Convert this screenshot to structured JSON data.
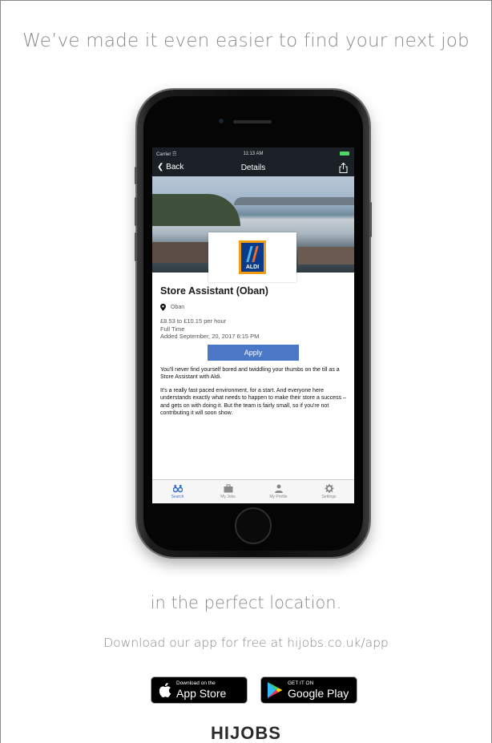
{
  "headline": "We’ve made it even easier to find your next job",
  "phone": {
    "status": {
      "carrier": "Carrier ☶",
      "time": "11:13 AM"
    },
    "nav": {
      "back": "❮ Back",
      "title": "Details"
    },
    "logo_text": "ALDI",
    "job": {
      "title": "Store Assistant (Oban)",
      "location": "Oban",
      "salary": "£8.53 to £10.15 per hour",
      "type": "Full Time",
      "added": "Added September, 20, 2017 6:15 PM",
      "apply_label": "Apply",
      "para1": "You'll never find yourself bored and twiddling your thumbs on the till as a Store Assistant with Aldi.",
      "para2": "It's a really fast paced environment, for a start. And everyone here understands exactly what needs to happen to make their store a success – and gets on with doing it. But the team is fairly small, so if you're not contributing it will soon show."
    },
    "tabs": [
      {
        "label": "Search",
        "icon": "binoculars-icon"
      },
      {
        "label": "My Jobs",
        "icon": "briefcase-icon"
      },
      {
        "label": "My Profile",
        "icon": "person-icon"
      },
      {
        "label": "Settings",
        "icon": "gear-icon"
      }
    ]
  },
  "subheading": "in the perfect location.",
  "download_text": "Download our app for free at hijobs.co.uk/app",
  "badges": {
    "apple": {
      "small": "Download on the",
      "big": "App Store"
    },
    "google": {
      "small": "GET IT ON",
      "big": "Google Play"
    }
  },
  "brand": "HIJOBS"
}
